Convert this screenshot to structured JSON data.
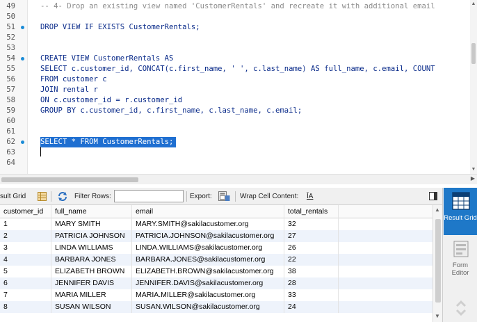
{
  "editor": {
    "lines": [
      {
        "num": "49",
        "text": "-- 4- Drop an existing view named 'CustomerRentals' and recreate it with additional email",
        "kind": "comment",
        "marker": false
      },
      {
        "num": "50",
        "text": "",
        "kind": "code",
        "marker": false
      },
      {
        "num": "51",
        "text": "DROP VIEW IF EXISTS CustomerRentals;",
        "kind": "code",
        "marker": true
      },
      {
        "num": "52",
        "text": "",
        "kind": "code",
        "marker": false
      },
      {
        "num": "53",
        "text": "",
        "kind": "code",
        "marker": false
      },
      {
        "num": "54",
        "text": "CREATE VIEW CustomerRentals AS",
        "kind": "code",
        "marker": true
      },
      {
        "num": "55",
        "text": "SELECT c.customer_id, CONCAT(c.first_name, ' ', c.last_name) AS full_name, c.email, COUNT",
        "kind": "code",
        "marker": false
      },
      {
        "num": "56",
        "text": "FROM customer c",
        "kind": "code",
        "marker": false
      },
      {
        "num": "57",
        "text": "JOIN rental r",
        "kind": "code",
        "marker": false
      },
      {
        "num": "58",
        "text": "ON c.customer_id = r.customer_id",
        "kind": "code",
        "marker": false
      },
      {
        "num": "59",
        "text": "GROUP BY c.customer_id, c.first_name, c.last_name, c.email;",
        "kind": "code",
        "marker": false
      },
      {
        "num": "60",
        "text": "",
        "kind": "code",
        "marker": false
      },
      {
        "num": "61",
        "text": "",
        "kind": "code",
        "marker": false
      },
      {
        "num": "62",
        "text": "SELECT * FROM CustomerRentals;",
        "kind": "selected",
        "marker": true
      },
      {
        "num": "63",
        "text": "",
        "kind": "code",
        "marker": false
      },
      {
        "num": "64",
        "text": "",
        "kind": "code",
        "marker": false
      }
    ]
  },
  "result_toolbar": {
    "tab_label": "sult Grid",
    "filter_rows_label": "Filter Rows:",
    "filter_value": "",
    "export_label": "Export:",
    "wrap_label": "Wrap Cell Content:",
    "wrap_icon": "ĪA"
  },
  "grid": {
    "columns": [
      "customer_id",
      "full_name",
      "email",
      "total_rentals"
    ],
    "rows": [
      [
        "1",
        "MARY SMITH",
        "MARY.SMITH@sakilacustomer.org",
        "32"
      ],
      [
        "2",
        "PATRICIA JOHNSON",
        "PATRICIA.JOHNSON@sakilacustomer.org",
        "27"
      ],
      [
        "3",
        "LINDA WILLIAMS",
        "LINDA.WILLIAMS@sakilacustomer.org",
        "26"
      ],
      [
        "4",
        "BARBARA JONES",
        "BARBARA.JONES@sakilacustomer.org",
        "22"
      ],
      [
        "5",
        "ELIZABETH BROWN",
        "ELIZABETH.BROWN@sakilacustomer.org",
        "38"
      ],
      [
        "6",
        "JENNIFER DAVIS",
        "JENNIFER.DAVIS@sakilacustomer.org",
        "28"
      ],
      [
        "7",
        "MARIA MILLER",
        "MARIA.MILLER@sakilacustomer.org",
        "33"
      ],
      [
        "8",
        "SUSAN WILSON",
        "SUSAN.WILSON@sakilacustomer.org",
        "24"
      ]
    ]
  },
  "side_panel": {
    "result_grid_label": "Result Grid",
    "form_editor_label": "Form Editor"
  },
  "colors": {
    "accent": "#1e78c8",
    "selection": "#1f6fd1",
    "keyword": "#0a2b8a",
    "comment": "#8c8c8c",
    "alt_row": "#eef3fb"
  },
  "icons": [
    "grid-icon",
    "refresh-icon",
    "export-icon",
    "wrap-icon",
    "panel-toggle-icon",
    "result-grid-icon",
    "form-editor-icon"
  ]
}
